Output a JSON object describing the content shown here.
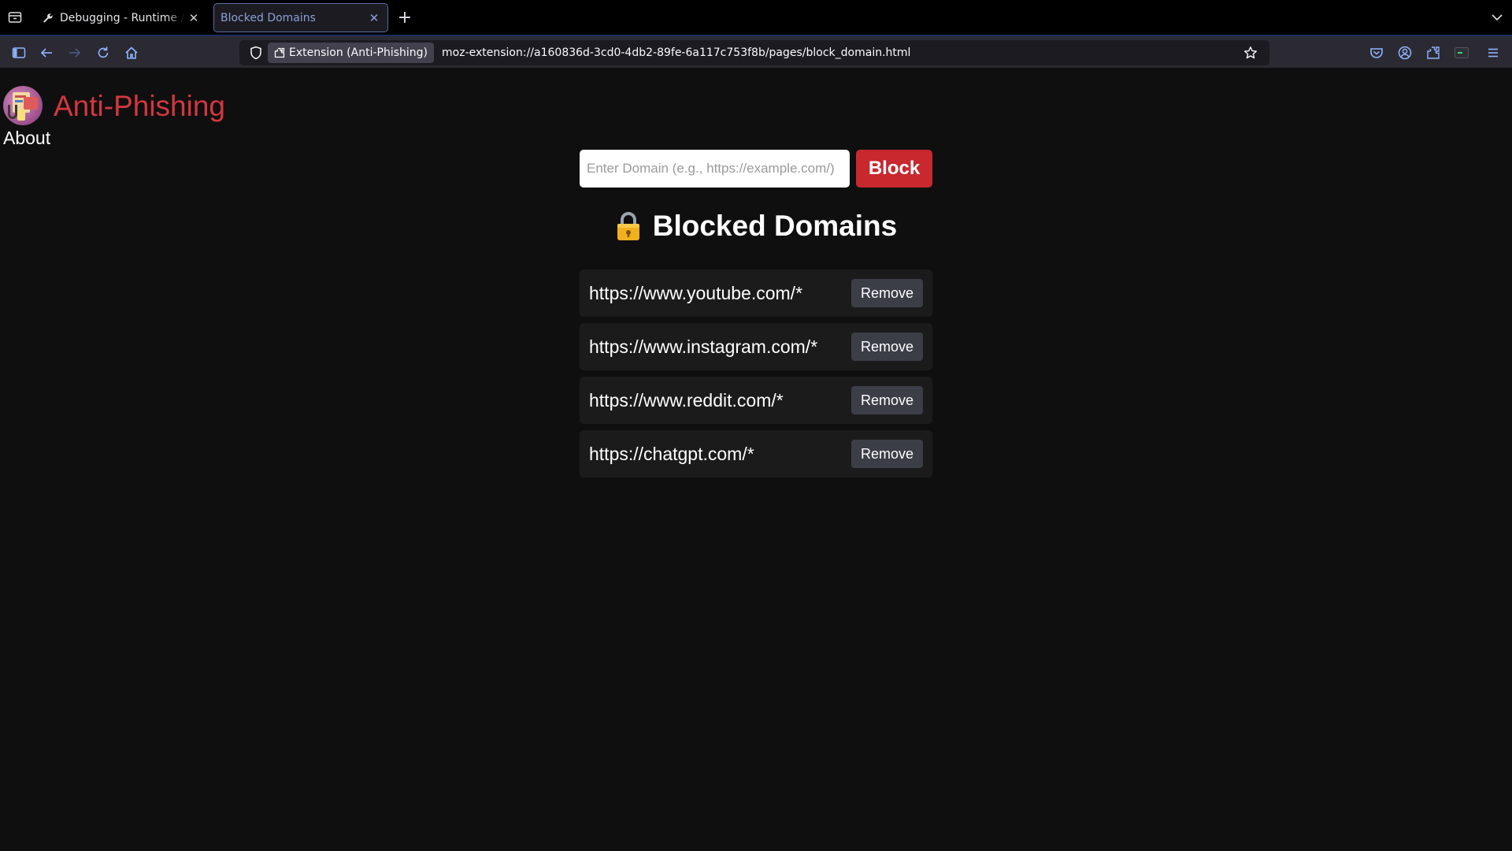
{
  "browser": {
    "tabs": [
      {
        "title": "Debugging - Runtime / this-firefox",
        "active": false,
        "icon": "wrench-icon"
      },
      {
        "title": "Blocked Domains",
        "active": true
      }
    ],
    "identity_label": "Extension (Anti-Phishing)",
    "url": "moz-extension://a160836d-3cd0-4db2-89fe-6a117c753f8b/pages/block_domain.html"
  },
  "page": {
    "brand_title": "Anti-Phishing",
    "about_label": "About",
    "input_placeholder": "Enter Domain (e.g., https://example.com/)",
    "input_value": "",
    "block_button": "Block",
    "list_title": "Blocked Domains",
    "list_icon": "lock-icon",
    "remove_label": "Remove",
    "blocked_domains": [
      "https://www.youtube.com/*",
      "https://www.instagram.com/*",
      "https://www.reddit.com/*",
      "https://chatgpt.com/*"
    ]
  },
  "colors": {
    "accent": "#d3373e",
    "block_button": "#c8282e",
    "page_background": "#0f0f10",
    "row_background": "#1b1b1c",
    "remove_button": "#3b3e47"
  }
}
